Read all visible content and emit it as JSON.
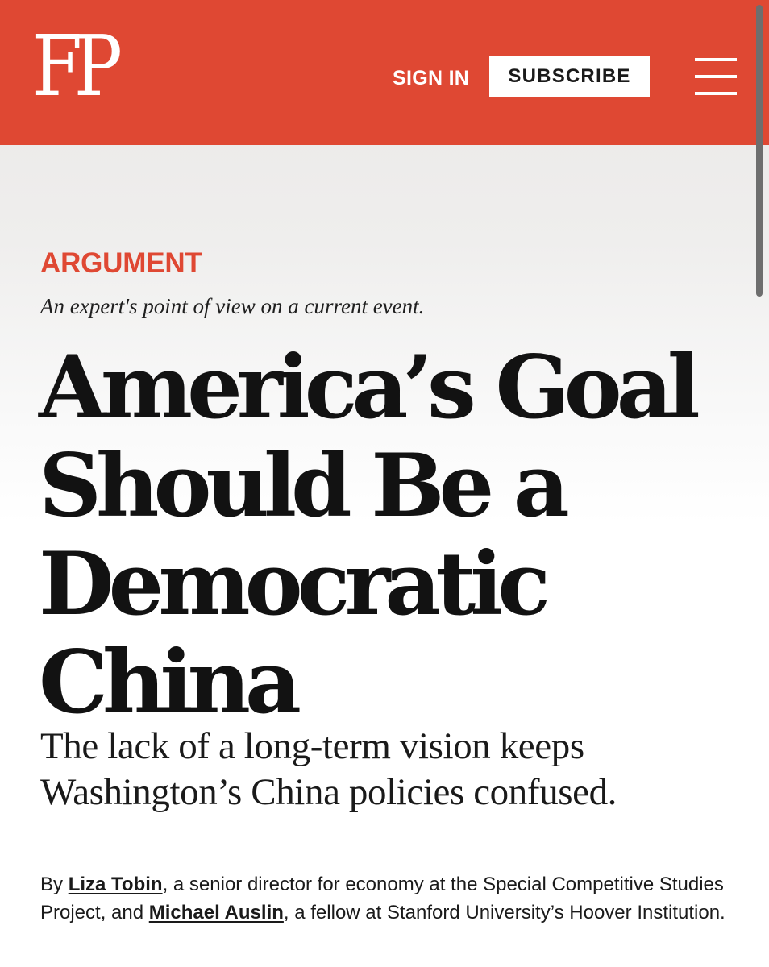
{
  "header": {
    "logo_text": "FP",
    "sign_in_label": "SIGN IN",
    "subscribe_label": "SUBSCRIBE",
    "menu_icon": "hamburger-menu-icon",
    "background_color": "#df4833"
  },
  "article": {
    "kicker": "ARGUMENT",
    "kicker_description": "An expert's point of view on a current event.",
    "headline_lines": [
      "America’s Goal",
      "Should Be a",
      "Democratic",
      "China"
    ],
    "dek_lines": [
      "The lack of a long-term vision keeps",
      "Washington’s China policies confused."
    ],
    "byline": {
      "prefix": "By ",
      "author1": "Liza Tobin",
      "author1_desc": ", a senior director for economy at the Special Competitive Studies Project, and ",
      "author2": "Michael Auslin",
      "author2_desc": ", a fellow at Stanford University’s Hoover Institution."
    },
    "accent_color": "#df4833"
  }
}
